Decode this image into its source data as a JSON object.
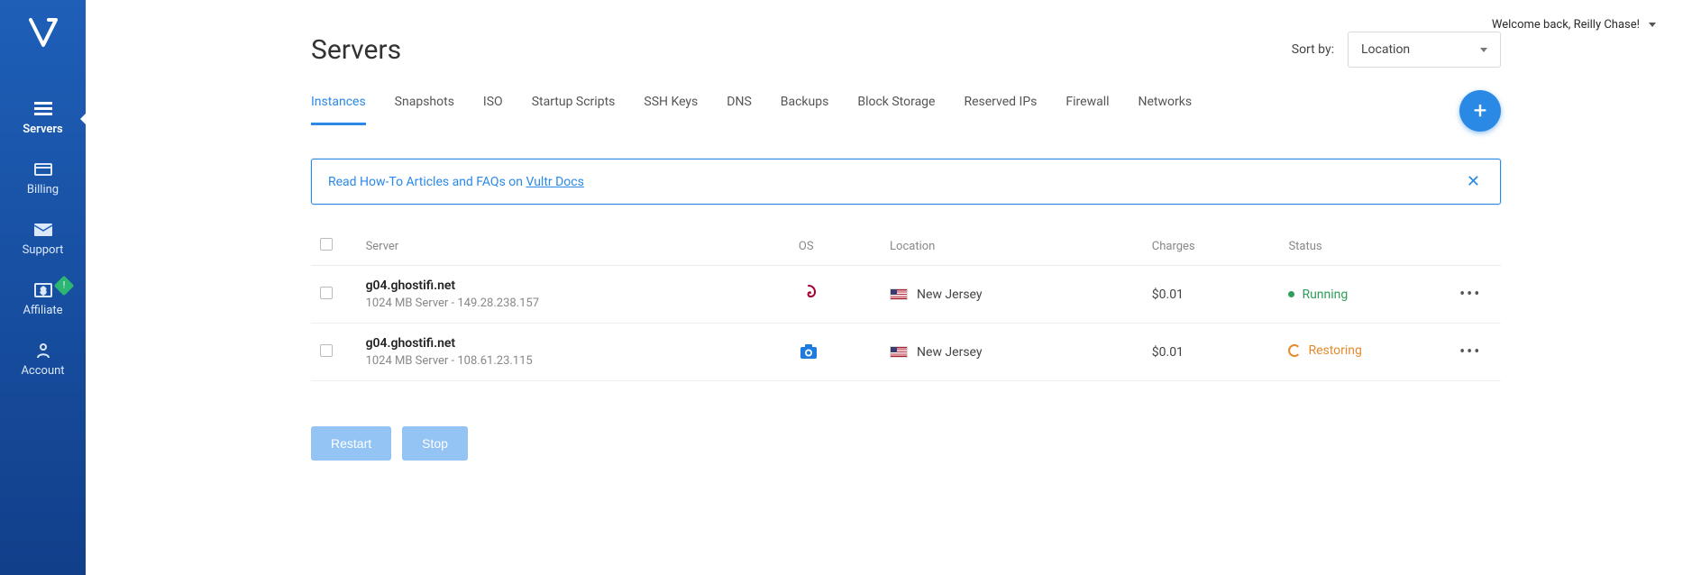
{
  "welcome": "Welcome back, Reilly Chase!",
  "page_title": "Servers",
  "sort": {
    "label": "Sort by:",
    "value": "Location"
  },
  "nav": [
    {
      "label": "Servers",
      "active": true
    },
    {
      "label": "Billing",
      "active": false
    },
    {
      "label": "Support",
      "active": false
    },
    {
      "label": "Affiliate",
      "active": false,
      "badge": true
    },
    {
      "label": "Account",
      "active": false
    }
  ],
  "tabs": [
    {
      "label": "Instances",
      "active": true
    },
    {
      "label": "Snapshots",
      "active": false
    },
    {
      "label": "ISO",
      "active": false
    },
    {
      "label": "Startup Scripts",
      "active": false
    },
    {
      "label": "SSH Keys",
      "active": false
    },
    {
      "label": "DNS",
      "active": false
    },
    {
      "label": "Backups",
      "active": false
    },
    {
      "label": "Block Storage",
      "active": false
    },
    {
      "label": "Reserved IPs",
      "active": false
    },
    {
      "label": "Firewall",
      "active": false
    },
    {
      "label": "Networks",
      "active": false
    }
  ],
  "banner": {
    "text": "Read How-To Articles and FAQs on ",
    "link_text": "Vultr Docs"
  },
  "columns": {
    "server": "Server",
    "os": "OS",
    "location": "Location",
    "charges": "Charges",
    "status": "Status"
  },
  "rows": [
    {
      "name": "g04.ghostifi.net",
      "sub": "1024 MB Server - 149.28.238.157",
      "os": "debian",
      "location": "New Jersey",
      "charges": "$0.01",
      "status": "Running",
      "status_kind": "running"
    },
    {
      "name": "g04.ghostifi.net",
      "sub": "1024 MB Server - 108.61.23.115",
      "os": "snapshot",
      "location": "New Jersey",
      "charges": "$0.01",
      "status": "Restoring",
      "status_kind": "restoring"
    }
  ],
  "buttons": {
    "restart": "Restart",
    "stop": "Stop"
  },
  "icons": {
    "debian_color": "#a80030",
    "snapshot_color": "#1f7ae0"
  }
}
